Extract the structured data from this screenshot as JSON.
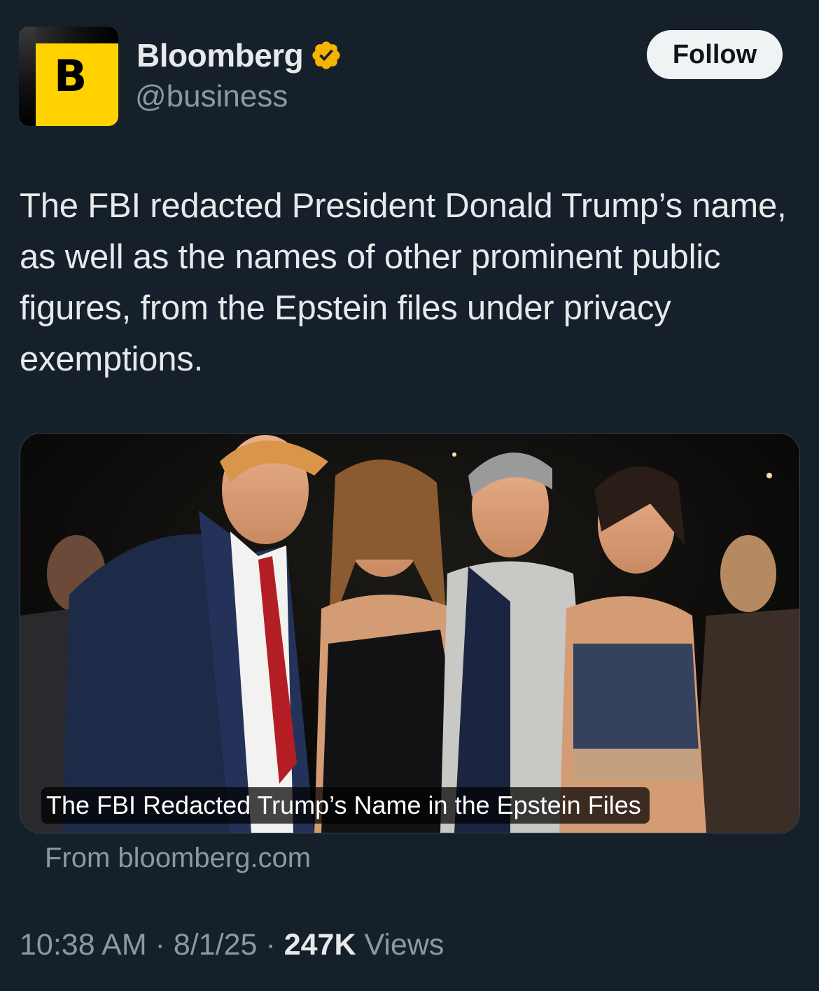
{
  "author": {
    "display_name": "Bloomberg",
    "handle": "@business",
    "avatar_letter": "B",
    "verified_icon": "verified-badge-icon",
    "verified_color": "#f4b400"
  },
  "follow_button": {
    "label": "Follow"
  },
  "tweet": {
    "text": "The FBI redacted President Donald Trump’s name, as well as the names of other prominent public figures, from the Epstein files under privacy exemptions."
  },
  "card": {
    "image_description_icon": "photo-image",
    "headline": "The FBI Redacted Trump’s Name in the Epstein Files",
    "source": "From bloomberg.com"
  },
  "meta": {
    "time": "10:38 AM",
    "separator": "·",
    "date": "8/1/25",
    "views_count": "247K",
    "views_label": "Views"
  },
  "colors": {
    "background": "#15202b",
    "text_primary": "#e7e9ea",
    "text_secondary": "#8b98a5",
    "brand_yellow": "#ffd200"
  }
}
